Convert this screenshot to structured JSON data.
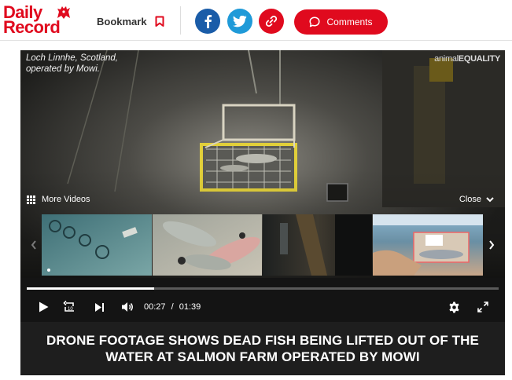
{
  "brand": {
    "line1": "Daily",
    "line2": "Record",
    "color": "#e00a1e"
  },
  "header": {
    "bookmark_label": "Bookmark",
    "comments_label": "Comments",
    "social": [
      {
        "name": "facebook",
        "icon": "facebook-icon",
        "color": "#1a5ca8"
      },
      {
        "name": "twitter",
        "icon": "twitter-icon",
        "color": "#1f9ad8"
      },
      {
        "name": "copy-link",
        "icon": "link-icon",
        "color": "#e00a1e"
      }
    ]
  },
  "player": {
    "caption_line1": "Loch Linnhe, Scotland,",
    "caption_line2": "operated by Mowi.",
    "watermark_light": "animal",
    "watermark_bold": "EQUALITY",
    "more_videos_label": "More Videos",
    "close_label": "Close",
    "current_time": "00:27",
    "separator": "/",
    "duration": "01:39",
    "progress_fraction": 0.27,
    "thumbnails": [
      {
        "name": "aerial-salmon-pens",
        "caption": ""
      },
      {
        "name": "dead-salmon-pile",
        "caption": ""
      },
      {
        "name": "boat-deck-interior",
        "caption": ""
      },
      {
        "name": "hand-holding-fish-tray",
        "caption": ""
      }
    ]
  },
  "headline": "DRONE FOOTAGE SHOWS DEAD FISH BEING LIFTED OUT OF THE WATER AT SALMON FARM OPERATED BY MOWI"
}
